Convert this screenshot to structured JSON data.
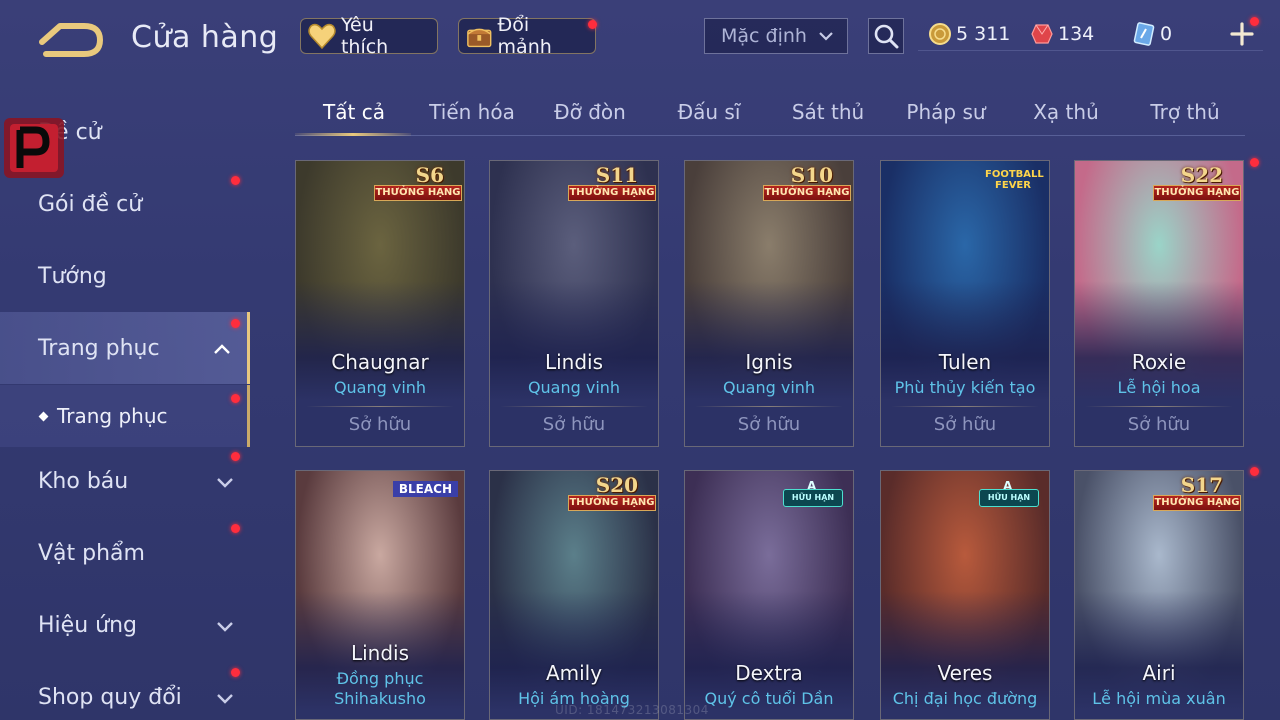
{
  "header": {
    "title": "Cửa hàng",
    "favorites_label": "Yêu thích",
    "shard_exchange_label": "Đổi mảnh",
    "sort_selected": "Mặc định",
    "currencies": [
      {
        "name": "gold",
        "value": "5 311"
      },
      {
        "name": "ruby",
        "value": "134"
      },
      {
        "name": "card",
        "value": "0"
      }
    ]
  },
  "sidebar": {
    "items": [
      {
        "label": "Đề cử"
      },
      {
        "label": "Gói đề cử"
      },
      {
        "label": "Tướng"
      },
      {
        "label": "Trang phục"
      },
      {
        "label": "Kho báu"
      },
      {
        "label": "Vật phẩm"
      },
      {
        "label": "Hiệu ứng"
      },
      {
        "label": "Shop quy đổi"
      }
    ],
    "sub_item": "Trang phục"
  },
  "tabs": [
    "Tất cả",
    "Tiến hóa",
    "Đỡ đòn",
    "Đấu sĩ",
    "Sát thủ",
    "Pháp sư",
    "Xạ thủ",
    "Trợ thủ"
  ],
  "cards": [
    {
      "hero": "Chaugnar",
      "skin": "Quang vinh",
      "status": "Sở hữu",
      "badge": "S6",
      "badge_text": "THƯỞNG HẠNG",
      "colors": [
        "#6b6440",
        "#3d3a2c"
      ]
    },
    {
      "hero": "Lindis",
      "skin": "Quang vinh",
      "status": "Sở hữu",
      "badge": "S11",
      "badge_text": "THƯỞNG HẠNG",
      "colors": [
        "#5b5e7c",
        "#2e3150"
      ]
    },
    {
      "hero": "Ignis",
      "skin": "Quang vinh",
      "status": "Sở hữu",
      "badge": "S10",
      "badge_text": "THƯỞNG HẠNG",
      "colors": [
        "#8a7d6b",
        "#4a3f3b"
      ]
    },
    {
      "hero": "Tulen",
      "skin": "Phù thủy kiến tạo",
      "status": "Sở hữu",
      "badge_tag": "FOOTBALL FEVER",
      "colors": [
        "#2a67a8",
        "#1a2f66"
      ]
    },
    {
      "hero": "Roxie",
      "skin": "Lễ hội hoa",
      "status": "Sở hữu",
      "badge": "S22",
      "badge_text": "THƯỞNG HẠNG",
      "colors": [
        "#9ad4c8",
        "#c46a8a"
      ]
    },
    {
      "hero": "Lindis",
      "skin": "Đồng phục Shihakusho",
      "status": "",
      "badge_tag": "BLEACH",
      "colors": [
        "#c9a8a0",
        "#5a3b3e"
      ]
    },
    {
      "hero": "Amily",
      "skin": "Hội ám hoàng",
      "status": "",
      "badge": "S20",
      "badge_text": "THƯỞNG HẠNG",
      "colors": [
        "#5b7f8a",
        "#2b3148"
      ]
    },
    {
      "hero": "Dextra",
      "skin": "Quý cô tuổi Dần",
      "status": "",
      "badge_a": "A",
      "badge_a_text": "HỮU HẠN",
      "colors": [
        "#7a6d9a",
        "#3d2f55"
      ]
    },
    {
      "hero": "Veres",
      "skin": "Chị đại học đường",
      "status": "",
      "badge_a": "A",
      "badge_a_text": "HỮU HẠN",
      "colors": [
        "#b85a3c",
        "#5a2c2a"
      ]
    },
    {
      "hero": "Airi",
      "skin": "Lễ hội mùa xuân",
      "status": "",
      "badge": "S17",
      "badge_text": "THƯỞNG HẠNG",
      "colors": [
        "#a9b8cc",
        "#4a5168"
      ]
    }
  ],
  "footer": {
    "uid": "UID: 181473213081304"
  },
  "colors": {
    "accent_gold": "#e9c97d",
    "skin_name": "#5fc3e8",
    "notify_red": "#ff2d3d"
  }
}
